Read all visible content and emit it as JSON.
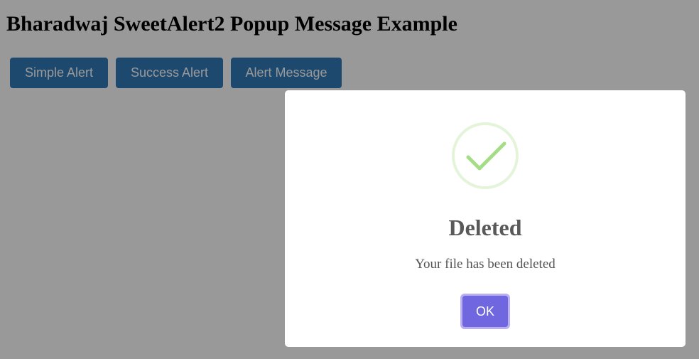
{
  "page": {
    "title": "Bharadwaj SweetAlert2 Popup Message Example",
    "buttons": {
      "simple_alert": "Simple Alert",
      "success_alert": "Success Alert",
      "alert_message": "Alert Message"
    }
  },
  "modal": {
    "icon": "success-check-icon",
    "title": "Deleted",
    "text": "Your file has been deleted",
    "ok_label": "OK"
  },
  "colors": {
    "button_primary": "#337ab7",
    "overlay": "rgba(0,0,0,0.4)",
    "success_icon": "#a5dc86",
    "confirm_button": "#7066e0"
  }
}
